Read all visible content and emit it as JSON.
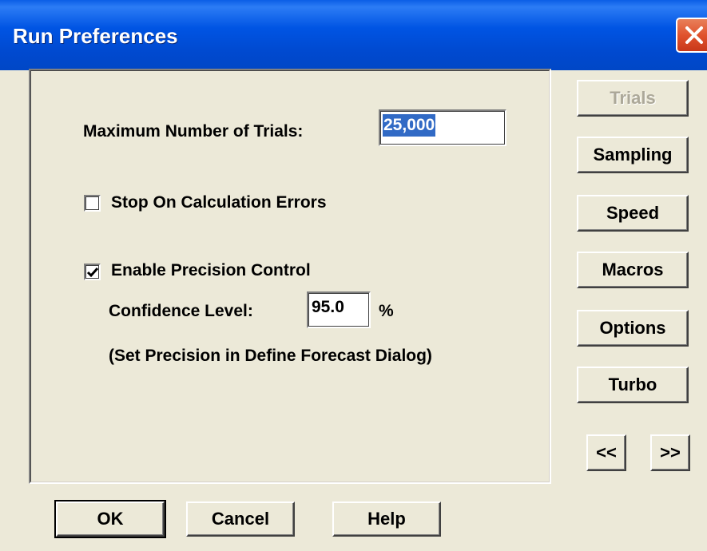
{
  "window": {
    "title": "Run Preferences"
  },
  "trials": {
    "max_label": "Maximum Number of Trials:",
    "max_value": "25,000"
  },
  "stop_errors": {
    "label": "Stop On Calculation Errors",
    "checked": false
  },
  "precision": {
    "label": "Enable Precision Control",
    "checked": true,
    "confidence_label": "Confidence Level:",
    "confidence_value": "95.0",
    "percent": "%",
    "note": "(Set Precision in Define Forecast Dialog)"
  },
  "side_buttons": {
    "trials": "Trials",
    "sampling": "Sampling",
    "speed": "Speed",
    "macros": "Macros",
    "options": "Options",
    "turbo": "Turbo",
    "prev": "<<",
    "next": ">>"
  },
  "footer": {
    "ok": "OK",
    "cancel": "Cancel",
    "help": "Help"
  }
}
